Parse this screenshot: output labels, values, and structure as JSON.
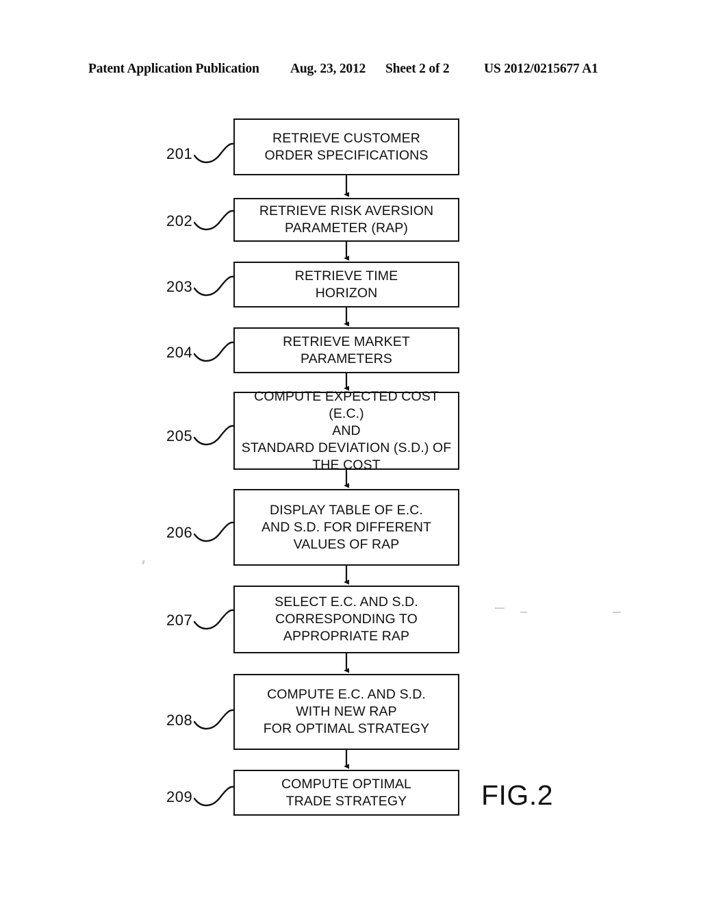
{
  "header": {
    "publication": "Patent Application Publication",
    "date": "Aug. 23, 2012",
    "sheet": "Sheet 2 of 2",
    "patent_number": "US 2012/0215677 A1"
  },
  "figure": {
    "caption": "FIG.2",
    "colors": {
      "ink": "#111111",
      "paper": "#ffffff"
    },
    "steps": [
      {
        "ref": "201",
        "text": "RETRIEVE CUSTOMER\nORDER SPECIFICATIONS"
      },
      {
        "ref": "202",
        "text": "RETRIEVE RISK AVERSION\nPARAMETER (RAP)"
      },
      {
        "ref": "203",
        "text": "RETRIEVE TIME\nHORIZON"
      },
      {
        "ref": "204",
        "text": "RETRIEVE MARKET\nPARAMETERS"
      },
      {
        "ref": "205",
        "text": "COMPUTE EXPECTED COST (E.C.)\nAND\nSTANDARD DEVIATION (S.D.) OF\nTHE COST"
      },
      {
        "ref": "206",
        "text": "DISPLAY TABLE OF E.C.\nAND S.D. FOR DIFFERENT\nVALUES OF RAP"
      },
      {
        "ref": "207",
        "text": "SELECT E.C. AND S.D.\nCORRESPONDING TO\nAPPROPRIATE RAP"
      },
      {
        "ref": "208",
        "text": "COMPUTE E.C. AND S.D.\nWITH NEW RAP\nFOR OPTIMAL STRATEGY"
      },
      {
        "ref": "209",
        "text": "COMPUTE OPTIMAL\nTRADE STRATEGY"
      }
    ]
  }
}
